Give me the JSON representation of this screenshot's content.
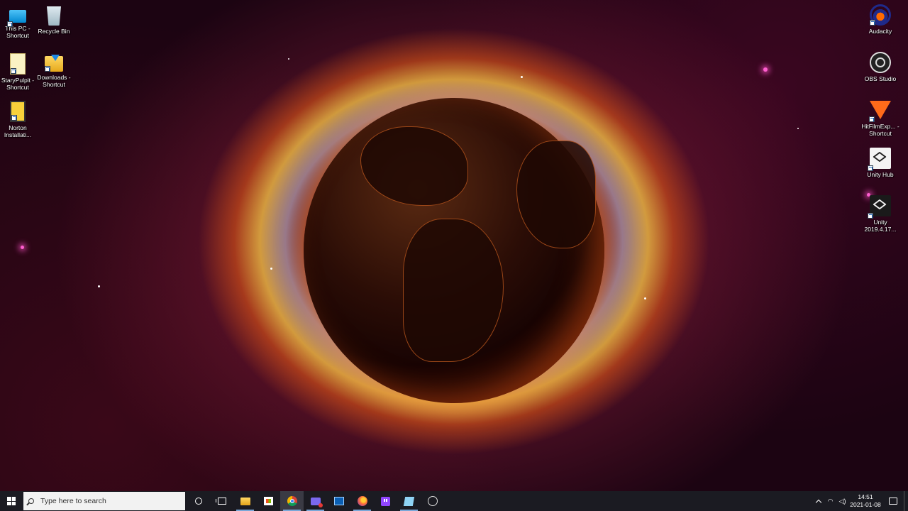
{
  "desktop": {
    "left_icons": [
      {
        "label": "This PC - Shortcut",
        "icon": "this-pc-icon"
      },
      {
        "label": "Recycle Bin",
        "icon": "recycle-bin-icon"
      },
      {
        "label": "StaryPulpit - Shortcut",
        "icon": "document-icon"
      },
      {
        "label": "Downloads - Shortcut",
        "icon": "downloads-folder-icon"
      },
      {
        "label": "Norton Installati...",
        "icon": "norton-icon"
      }
    ],
    "right_icons": [
      {
        "label": "Audacity",
        "icon": "audacity-icon"
      },
      {
        "label": "OBS Studio",
        "icon": "obs-icon"
      },
      {
        "label": "HitFilmExp... - Shortcut",
        "icon": "hitfilm-icon"
      },
      {
        "label": "Unity Hub",
        "icon": "unity-hub-icon"
      },
      {
        "label": "Unity 2019.4.17...",
        "icon": "unity-icon"
      }
    ]
  },
  "taskbar": {
    "search_placeholder": "Type here to search",
    "pinned_apps": [
      {
        "name": "File Explorer",
        "icon": "file-explorer-icon"
      },
      {
        "name": "Microsoft Store",
        "icon": "store-icon"
      },
      {
        "name": "Google Chrome",
        "icon": "chrome-icon"
      },
      {
        "name": "Inking app",
        "icon": "ink-icon"
      },
      {
        "name": "Remote Desktop",
        "icon": "remote-desktop-icon"
      },
      {
        "name": "Firefox",
        "icon": "firefox-icon"
      },
      {
        "name": "Twitch",
        "icon": "twitch-icon"
      },
      {
        "name": "HitFilm",
        "icon": "hitfilm-icon"
      },
      {
        "name": "OBS Studio",
        "icon": "obs-icon"
      }
    ],
    "clock": {
      "time": "14:51",
      "date": "2021-01-08"
    }
  },
  "colors": {
    "taskbar_bg": "#1b1b22",
    "accent": "#7aa7d8"
  }
}
